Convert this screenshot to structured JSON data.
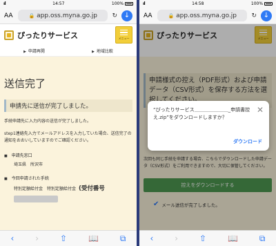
{
  "left": {
    "status": {
      "signal": "ııll",
      "time": "14:57",
      "battery": "100%"
    },
    "browser": {
      "aa": "AA",
      "url": "app.oss.myna.go.jp"
    },
    "site_title": "ぴったりサービス",
    "menu_label": "メニュー",
    "nav": [
      "申請再開",
      "地域比較"
    ],
    "page_title": "送信完了",
    "section_title": "申請先に送信が完了しました。",
    "para1": "手続申請先に入力内容の送信が完了しました。",
    "para2": "step1連絡先入力でメールアドレスを入力していた場合、送信完了の通知をおおいしていますのでご確認ください。",
    "dest_label": "申請先窓口",
    "dest_value": "埼玉県　所沢市",
    "proc_label": "今回申請された手続",
    "proc_value": "特別定額給付金　特別定額給付金",
    "receipt_label": "(受付番号",
    "toolbar": [
      "‹",
      "›",
      "⇧",
      "📖",
      "⧉"
    ]
  },
  "right": {
    "status": {
      "signal": "ııll",
      "time": "14:58",
      "battery": "100%"
    },
    "browser": {
      "aa": "AA",
      "url": "app.oss.myna.go.jp"
    },
    "site_title": "ぴったりサービス",
    "menu_label": "メニュー",
    "heading": "申請様式の控え（PDF形式）および申請データ（CSV形式）を保存する方法を選択してください。",
    "para": "次回も同じ手続を申請する場合、こちらでダウンロードした申請データ（CSV形式）をご利用できますので、大切に保管してください。",
    "save_button": "控えをダウンロードする",
    "sent_msg": "メール送信が完了しました。",
    "dialog": {
      "text": "“ぴったりサービス＿＿＿＿＿＿＿_申請書控え.zip”をダウンロードしますか？",
      "button": "ダウンロード",
      "close": "✕"
    },
    "toolbar": [
      "‹",
      "›",
      "⇧",
      "📖",
      "⧉"
    ]
  }
}
